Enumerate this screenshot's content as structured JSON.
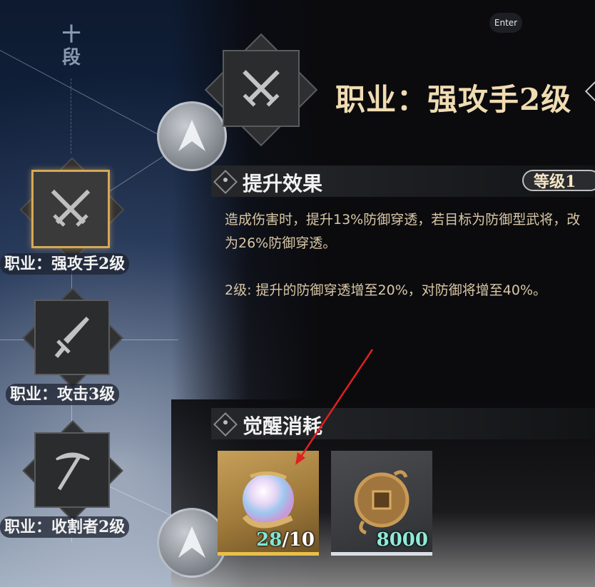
{
  "tree": {
    "rank_label": "十段",
    "nodes": [
      {
        "label": "职业：强攻手2级",
        "icon": "crossed-swords-icon",
        "selected": true
      },
      {
        "label": "职业：攻击3级",
        "icon": "sword-icon",
        "selected": false
      },
      {
        "label": "职业：收割者2级",
        "icon": "pickaxe-icon",
        "selected": false
      }
    ]
  },
  "enter_hint": "Enter",
  "detail": {
    "icon": "crossed-swords-icon",
    "title": "职业：强攻手2级",
    "effect": {
      "section_title": "提升效果",
      "level_pill": "等级1",
      "description_1": "造成伤害时，提升13%防御穿透，若目标为防御型武将，改为26%防御穿透。",
      "description_2": "2级: 提升的防御穿透增至20%，对防御将增至40%。"
    },
    "cost": {
      "section_title": "觉醒消耗",
      "items": [
        {
          "name": "orb-item",
          "have": "28",
          "need": "/10",
          "frame": "gold"
        },
        {
          "name": "coin-item",
          "count": "8000",
          "frame": "grey"
        }
      ]
    }
  },
  "colors": {
    "accent_gold": "#d6a857",
    "title_text": "#f0dcb2",
    "desc_text": "#d9c7a5",
    "count_teal": "#8fead9"
  }
}
